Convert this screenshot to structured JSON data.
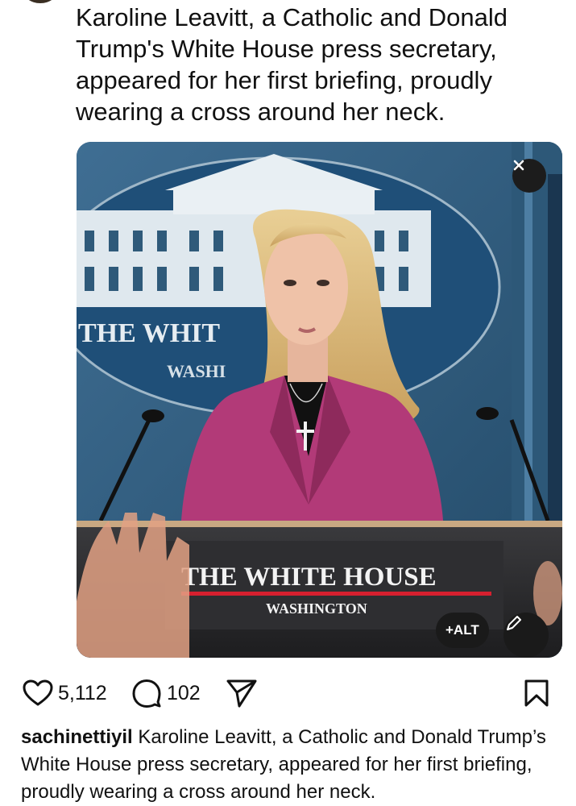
{
  "post": {
    "text": "Karoline Leavitt, a Catholic and Donald Trump's White House press secretary, appeared for her first briefing, proudly wearing a cross around her neck."
  },
  "media": {
    "podium_title": "THE WHITE HOUSE",
    "podium_subtitle": "WASHINGTON",
    "seal_title": "THE WHIT",
    "seal_subtitle": "WASHI",
    "alt_label": "+ALT"
  },
  "actions": {
    "likes": "5,112",
    "comments": "102"
  },
  "caption": {
    "username": "sachinettiyil",
    "text": "Karoline Leavitt, a Catholic and Donald Trump’s White House press secretary, appeared for her first briefing, proudly wearing a cross around her neck."
  },
  "icons": {
    "like": "heart-icon",
    "comment": "comment-bubble-icon",
    "share": "send-icon",
    "save": "bookmark-icon",
    "close": "close-icon",
    "edit": "pencil-icon"
  }
}
